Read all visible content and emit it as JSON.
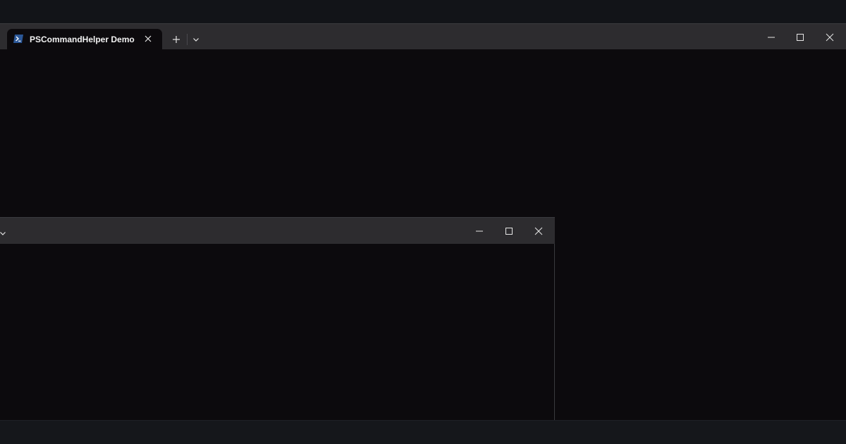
{
  "main_window": {
    "tab": {
      "title": "PSCommandHelper Demo",
      "icon": "powershell-icon"
    },
    "buttons": {
      "close_tab": "close-icon",
      "new_tab": "plus-icon",
      "dropdown": "chevron-down-icon",
      "minimize": "minimize-icon",
      "maximize": "maximize-icon",
      "close": "close-icon"
    }
  },
  "second_window": {
    "buttons": {
      "dropdown": "chevron-down-icon",
      "minimize": "minimize-icon",
      "maximize": "maximize-icon",
      "close": "close-icon"
    }
  },
  "colors": {
    "desktop": "#121418",
    "terminal_background": "#0c0a0d",
    "titlebar": "#2d2c2f",
    "text": "#f2f2f2"
  }
}
